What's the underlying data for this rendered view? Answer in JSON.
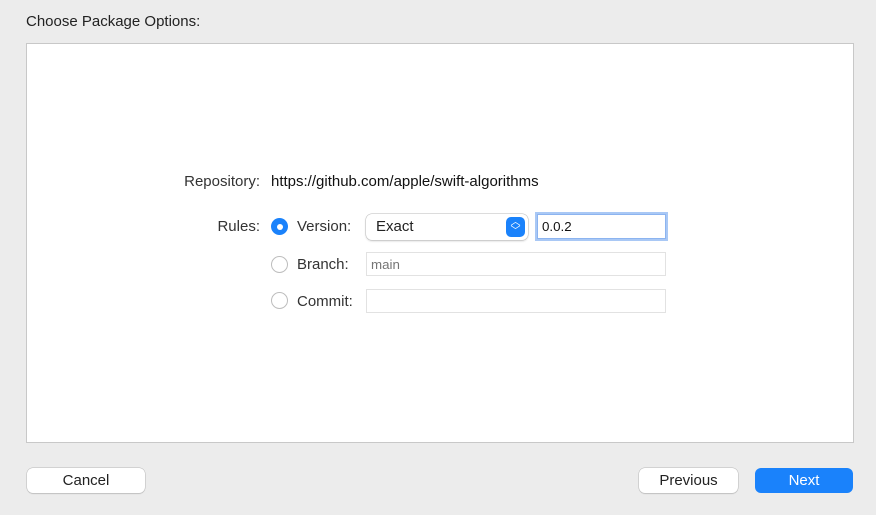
{
  "title": "Choose Package Options:",
  "repository": {
    "label": "Repository:",
    "value": "https://github.com/apple/swift-algorithms"
  },
  "rules": {
    "label": "Rules:",
    "version": {
      "label": "Version:",
      "selected": true,
      "rule": "Exact",
      "value": "0.0.2"
    },
    "branch": {
      "label": "Branch:",
      "selected": false,
      "placeholder": "main",
      "value": ""
    },
    "commit": {
      "label": "Commit:",
      "selected": false,
      "value": ""
    }
  },
  "buttons": {
    "cancel": "Cancel",
    "previous": "Previous",
    "next": "Next"
  },
  "icons": {
    "stepper": "up-down-chevron-icon"
  },
  "colors": {
    "accent": "#1a82fb"
  }
}
